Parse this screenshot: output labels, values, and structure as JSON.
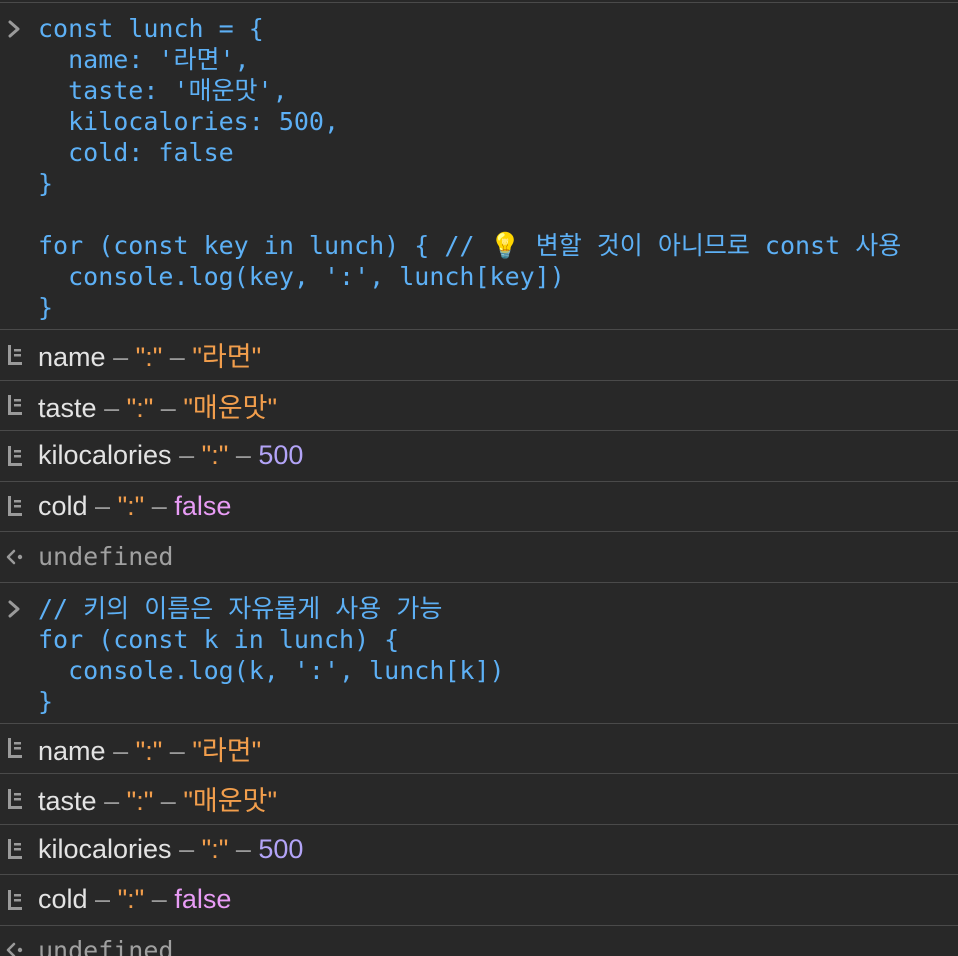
{
  "block1": {
    "lines": [
      "const lunch = {",
      "  name: '라면',",
      "  taste: '매운맛',",
      "  kilocalories: 500,",
      "  cold: false",
      "}",
      "",
      "for (const key in lunch) { // ",
      "  console.log(key, ':', lunch[key])",
      "}"
    ],
    "bulb_icon": "💡",
    "line8_suffix": " 변할 것이 아니므로 const 사용"
  },
  "logs1": [
    {
      "key": "name",
      "sep": "\":\"",
      "value": "\"라면\"",
      "type": "str"
    },
    {
      "key": "taste",
      "sep": "\":\"",
      "value": "\"매운맛\"",
      "type": "str"
    },
    {
      "key": "kilocalories",
      "sep": "\":\"",
      "value": "500",
      "type": "num"
    },
    {
      "key": "cold",
      "sep": "\":\"",
      "value": "false",
      "type": "bool"
    }
  ],
  "result1": "undefined",
  "block2": {
    "lines": [
      "// 키의 이름은 자유롭게 사용 가능",
      "for (const k in lunch) {",
      "  console.log(k, ':', lunch[k])",
      "}"
    ]
  },
  "logs2": [
    {
      "key": "name",
      "sep": "\":\"",
      "value": "\"라면\"",
      "type": "str"
    },
    {
      "key": "taste",
      "sep": "\":\"",
      "value": "\"매운맛\"",
      "type": "str"
    },
    {
      "key": "kilocalories",
      "sep": "\":\"",
      "value": "500",
      "type": "num"
    },
    {
      "key": "cold",
      "sep": "\":\"",
      "value": "false",
      "type": "bool"
    }
  ],
  "result2": "undefined",
  "dash": "–",
  "colors": {
    "background": "#282828",
    "code": "#5db0f5",
    "string": "#f29e4c",
    "number": "#b3a4f7",
    "boolean": "#e89cf5",
    "divider": "#4a4a4a"
  },
  "icons": {
    "prompt": "chevron-right-icon",
    "log": "log-list-icon",
    "result": "return-arrow-icon"
  }
}
